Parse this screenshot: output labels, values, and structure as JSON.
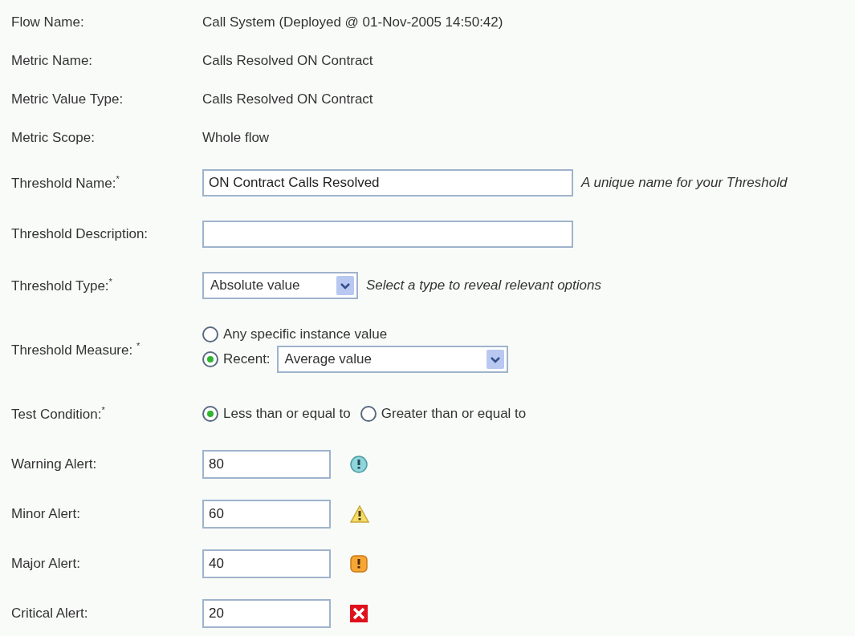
{
  "rows": [
    {
      "kind": "static",
      "label": "Flow Name:",
      "value": "Call System (Deployed @ 01-Nov-2005 14:50:42)"
    },
    {
      "kind": "static",
      "label": "Metric Name:",
      "value": "Calls Resolved ON Contract"
    },
    {
      "kind": "static",
      "label": "Metric Value Type:",
      "value": "Calls Resolved ON Contract"
    },
    {
      "kind": "static",
      "label": "Metric Scope:",
      "value": "Whole flow"
    },
    {
      "kind": "text",
      "label": "Threshold Name:$^{*}$",
      "value": "ON Contract Calls Resolved",
      "hint": "A unique name for your Threshold"
    },
    {
      "kind": "text",
      "label": "Threshold Description:"
    },
    {
      "kind": "select",
      "label": "Threshold Type:$^{*}$",
      "value": "Absolute value",
      "hint": "Select a type to reveal relevant options"
    },
    {
      "kind": "measure",
      "label": "Threshold Measure: $^{*}$",
      "options": [
        {
          "label": "Any specific instance value",
          "selected": false
        },
        {
          "label": "Recent:",
          "selected": true,
          "select": "Average value"
        }
      ]
    },
    {
      "kind": "radios",
      "label": "Test Condition:$^{*}$",
      "options": [
        {
          "label": "Less than or equal to",
          "selected": true
        },
        {
          "label": "Greater than or equal to",
          "selected": false
        }
      ]
    }
  ],
  "alerts": [
    {
      "kind": "warning",
      "label": "Warning Alert:",
      "value": "80"
    },
    {
      "kind": "minor",
      "label": "Minor Alert:",
      "value": "60"
    },
    {
      "kind": "major",
      "label": "Major Alert:",
      "value": "40"
    },
    {
      "kind": "critical",
      "label": "Critical Alert:",
      "value": "20"
    }
  ]
}
